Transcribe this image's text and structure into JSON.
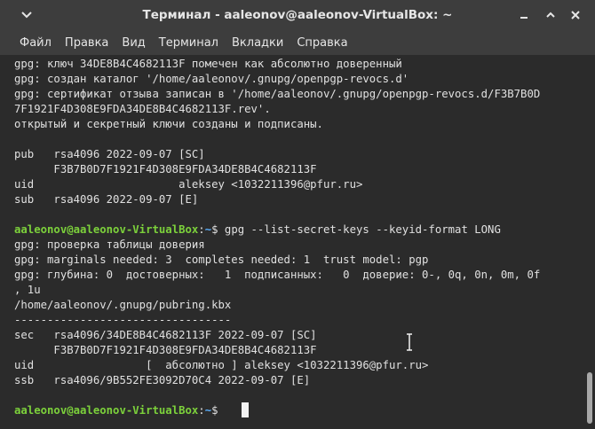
{
  "window": {
    "title": "Терминал - aaleonov@aaleonov-VirtualBox: ~"
  },
  "menubar": {
    "items": [
      "Файл",
      "Правка",
      "Вид",
      "Терминал",
      "Вкладки",
      "Справка"
    ]
  },
  "terminal": {
    "lines": [
      "gpg: ключ 34DE8B4C4682113F помечен как абсолютно доверенный",
      "gpg: создан каталог '/home/aaleonov/.gnupg/openpgp-revocs.d'",
      "gpg: сертификат отзыва записан в '/home/aaleonov/.gnupg/openpgp-revocs.d/F3B7B0D",
      "7F1921F4D308E9FDA34DE8B4C4682113F.rev'.",
      "открытый и секретный ключи созданы и подписаны.",
      "",
      "pub   rsa4096 2022-09-07 [SC]",
      "      F3B7B0D7F1921F4D308E9FDA34DE8B4C4682113F",
      "uid                      aleksey <1032211396@pfur.ru>",
      "sub   rsa4096 2022-09-07 [E]",
      "",
      "",
      "gpg: проверка таблицы доверия",
      "gpg: marginals needed: 3  completes needed: 1  trust model: pgp",
      "gpg: глубина: 0  достоверных:   1  подписанных:   0  доверие: 0-, 0q, 0n, 0m, 0f",
      ", 1u",
      "/home/aaleonov/.gnupg/pubring.kbx",
      "---------------------------------",
      "sec   rsa4096/34DE8B4C4682113F 2022-09-07 [SC]",
      "      F3B7B0D7F1921F4D308E9FDA34DE8B4C4682113F",
      "uid                 [  абсолютно ] aleksey <1032211396@pfur.ru>",
      "ssb   rsa4096/9B552FE3092D70C4 2022-09-07 [E]",
      ""
    ],
    "prompt1": {
      "user": "aaleonov@aaleonov-VirtualBox",
      "sep": ":",
      "path": "~",
      "symbol": "$",
      "command": " gpg --list-secret-keys --keyid-format LONG"
    },
    "prompt2": {
      "user": "aaleonov@aaleonov-VirtualBox",
      "sep": ":",
      "path": "~",
      "symbol": "$ "
    }
  }
}
